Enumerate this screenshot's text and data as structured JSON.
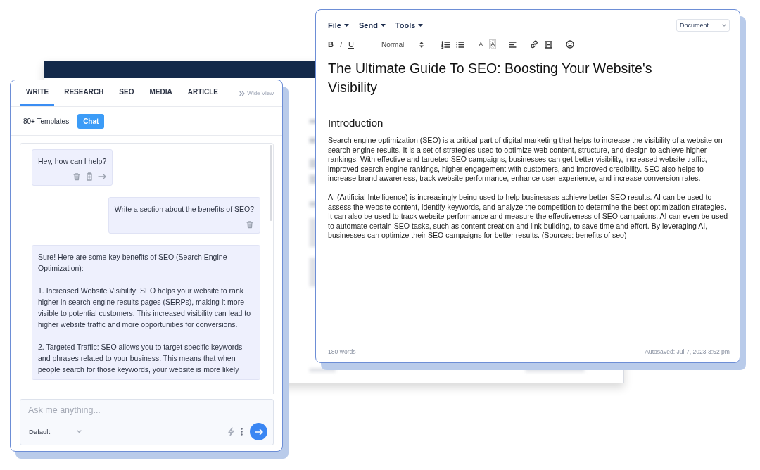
{
  "chat_panel": {
    "tabs": [
      {
        "label": "WRITE",
        "selected": true
      },
      {
        "label": "RESEARCH",
        "selected": false
      },
      {
        "label": "SEO",
        "selected": false
      },
      {
        "label": "MEDIA",
        "selected": false
      },
      {
        "label": "ARTICLE",
        "selected": false
      }
    ],
    "wide_view": "Wide View",
    "modes": [
      {
        "label": "80+ Templates",
        "selected": false
      },
      {
        "label": "Chat",
        "selected": true
      }
    ],
    "messages": [
      {
        "kind": "bot",
        "paragraphs": [
          "Hey, how can I help?"
        ],
        "can_delete": true,
        "can_copy": true,
        "can_reuse": true
      },
      {
        "kind": "user",
        "paragraphs": [
          "Write a section about the benefits of SEO?"
        ],
        "can_delete": true
      },
      {
        "kind": "bot",
        "paragraphs": [
          "Sure! Here are some key benefits of SEO (Search Engine Optimization):",
          "1. Increased Website Visibility: SEO helps your website to rank higher in search engine results pages (SERPs), making it more visible to potential customers. This increased visibility can lead to higher website traffic and more opportunities for conversions.",
          "2. Targeted Traffic: SEO allows you to target specific keywords and phrases related to your business. This means that when people search for those keywords, your website is more likely"
        ]
      }
    ],
    "composer": {
      "placeholder": "Ask me anything...",
      "model": "Default"
    }
  },
  "editor": {
    "menus": [
      "File",
      "Send",
      "Tools"
    ],
    "doc_type": "Document",
    "format_buttons": [
      "B",
      "I",
      "U"
    ],
    "paragraph_style": "Normal",
    "color_buttons": [
      {
        "label": "A",
        "kind": "text-color"
      },
      {
        "label": "A",
        "kind": "highlight"
      }
    ],
    "title": "The Ultimate Guide To SEO: Boosting Your Website's Visibility",
    "heading": "Introduction",
    "paragraphs": [
      "Search engine optimization (SEO) is a critical part of digital marketing that helps to increase the visibility of a website on search engine results. It is a set of strategies used to optimize web content, structure, and design to achieve higher rankings. With effective and targeted SEO campaigns, businesses can get better visibility, increased website traffic, improved search engine rankings, higher engagement with customers, and improved credibility. SEO also helps to increase brand awareness, track website performance, enhance user experience, and increase conversion rates.",
      "AI (Artificial Intelligence) is increasingly being used to help businesses achieve better SEO results. AI can be used to assess the website content, identify keywords, and analyze the competition to determine the best optimization strategies. It can also be used to track website performance and measure the effectiveness of SEO campaigns. AI can even be used to automate certain SEO tasks, such as content creation and link building, to save time and effort. By leveraging AI, businesses can optimize their SEO campaigns for better results. (Sources: benefits of seo)"
    ],
    "word_count": "180 words",
    "autosave": "Autosaved: Jul 7, 2023 3:52 pm"
  }
}
